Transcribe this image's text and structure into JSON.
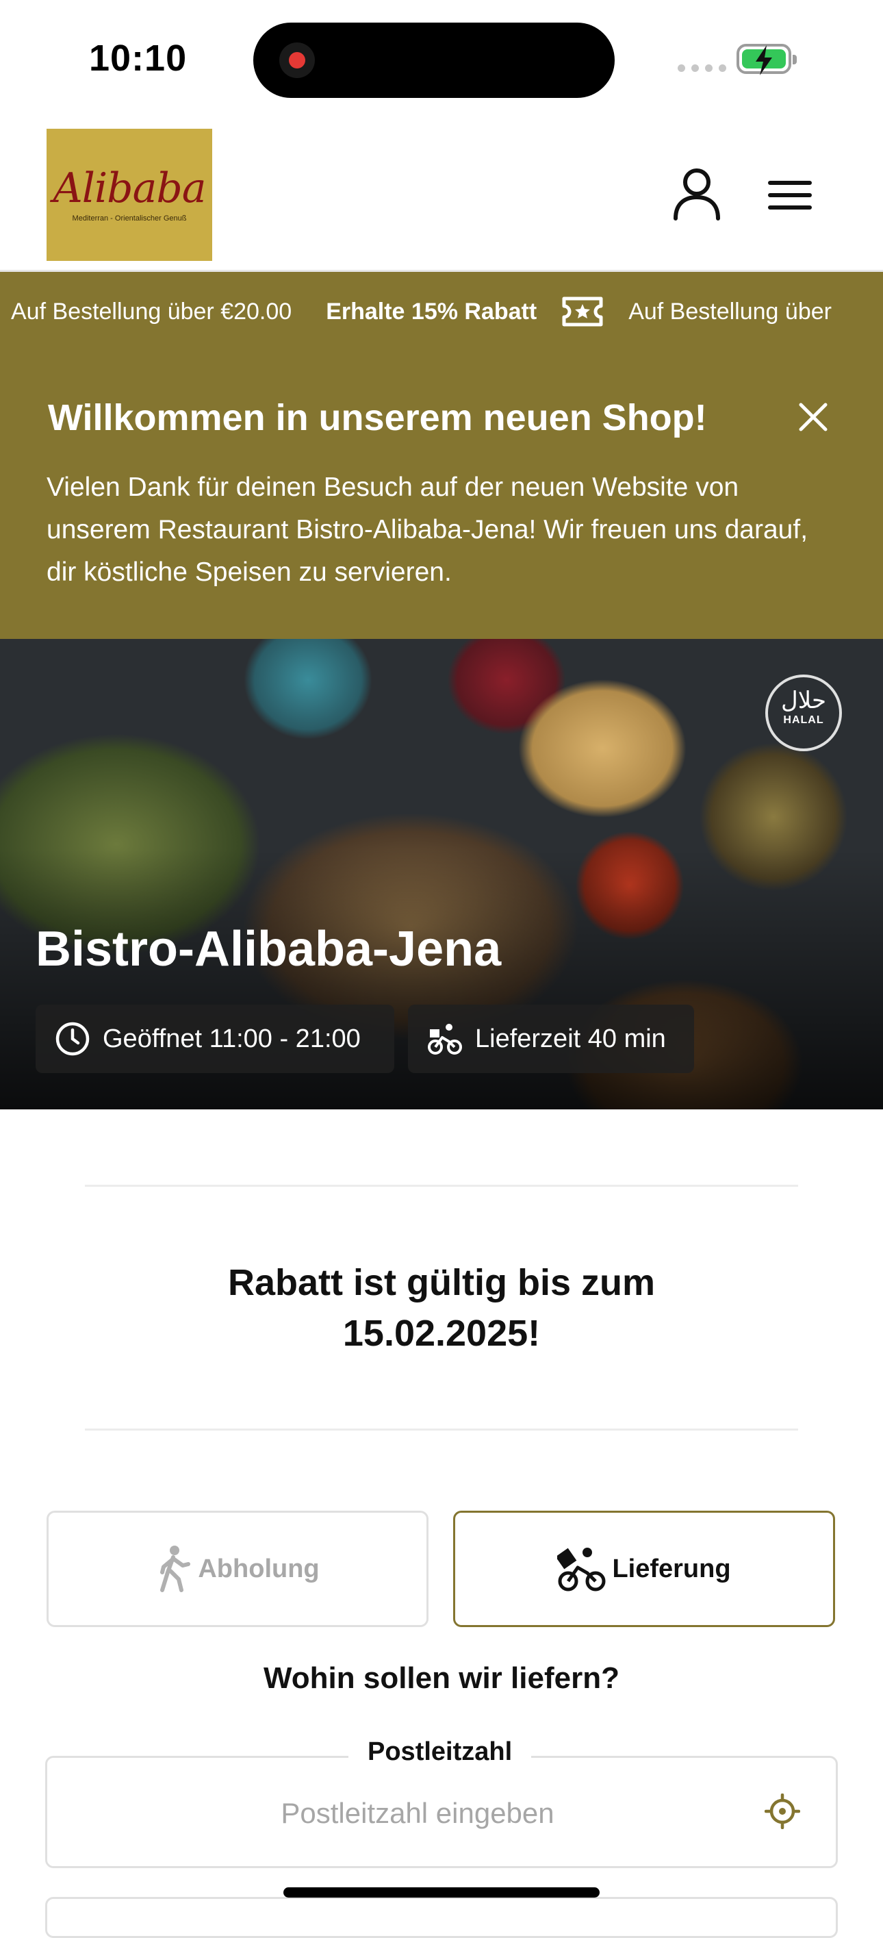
{
  "status_bar": {
    "time": "10:10"
  },
  "header": {
    "logo_text": "Alibaba",
    "logo_subtitle": "Mediterran - Orientalischer Genuß",
    "account_icon": "user-icon",
    "menu_icon": "hamburger-menu-icon"
  },
  "promo_ticker": {
    "min_order_text": "Auf Bestellung über €20.00",
    "discount_text": "Erhalte 15% Rabatt",
    "repeat_text": "Auf Bestellung über",
    "icon": "ticket-star-icon"
  },
  "welcome_banner": {
    "title": "Willkommen in unserem neuen Shop!",
    "text": "Vielen Dank für deinen Besuch auf der neuen Website von unserem Restaurant Bistro-Alibaba-Jena! Wir freuen uns darauf, dir köstliche Speisen zu servieren.",
    "close_icon": "close-icon"
  },
  "hero": {
    "restaurant_name": "Bistro-Alibaba-Jena",
    "halal_arabic": "حلال",
    "halal_label": "HALAL",
    "opening_hours": "Geöffnet 11:00 - 21:00",
    "delivery_time": "Lieferzeit 40 min"
  },
  "discount_notice": {
    "line1": "Rabatt ist gültig bis zum",
    "line2": "15.02.2025!"
  },
  "order_mode": {
    "pickup_label": "Abholung",
    "delivery_label": "Lieferung",
    "selected": "Lieferung"
  },
  "delivery_form": {
    "question": "Wohin sollen wir liefern?",
    "postcode_label": "Postleitzahl",
    "postcode_placeholder": "Postleitzahl eingeben",
    "postcode_value": ""
  },
  "colors": {
    "brand_olive": "#847530",
    "logo_gold": "#c9ad45",
    "logo_red": "#8a1414"
  }
}
